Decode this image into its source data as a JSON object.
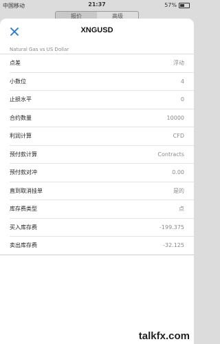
{
  "status_bar": {
    "carrier": "中国移动",
    "time": "21:37",
    "battery": "57%"
  },
  "background_tabs": [
    "报价",
    "高级"
  ],
  "sheet": {
    "title": "XNGUSD",
    "subtitle": "Natural Gas vs US Dollar",
    "rows": [
      {
        "label": "点差",
        "value": "浮动"
      },
      {
        "label": "小数位",
        "value": "4"
      },
      {
        "label": "止损水平",
        "value": "0"
      },
      {
        "label": "合约数量",
        "value": "10000"
      },
      {
        "label": "利润计算",
        "value": "CFD"
      },
      {
        "label": "预付款计算",
        "value": "Contracts"
      },
      {
        "label": "预付款对冲",
        "value": "0.00"
      },
      {
        "label": "直到取消挂单",
        "value": "是的"
      },
      {
        "label": "库存费类型",
        "value": "点"
      },
      {
        "label": "买入库存费",
        "value": "-199.375"
      },
      {
        "label": "卖出库存费",
        "value": "-32.125"
      }
    ]
  },
  "watermark": "talkfx.com",
  "colors": {
    "accent": "#2a7de1"
  }
}
